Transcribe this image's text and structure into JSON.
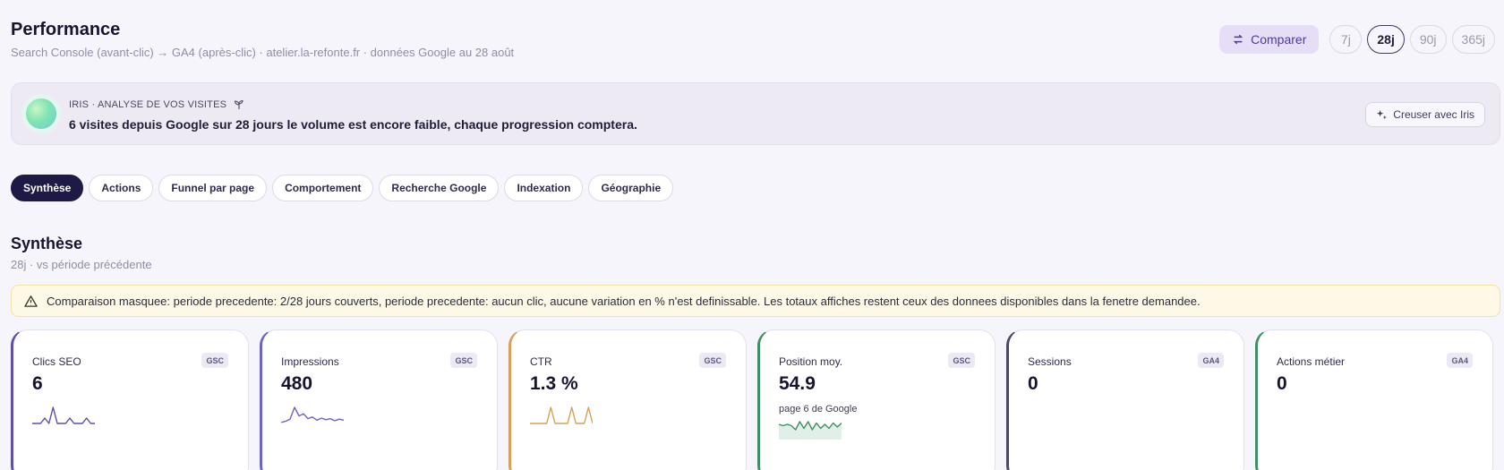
{
  "header": {
    "title": "Performance",
    "subtitle": "Search Console (avant-clic) → GA4 (après-clic) · atelier.la-refonte.fr · données Google au 28 août"
  },
  "controls": {
    "compare_label": "Comparer",
    "periods": [
      "7j",
      "28j",
      "90j",
      "365j"
    ],
    "active_period": "28j"
  },
  "iris": {
    "label": "IRIS · ANALYSE DE VOS VISITES",
    "message": "6 visites depuis Google sur 28 jours le volume est encore faible, chaque progression comptera.",
    "button_label": "Creuser avec Iris"
  },
  "tabs": [
    "Synthèse",
    "Actions",
    "Funnel par page",
    "Comportement",
    "Recherche Google",
    "Indexation",
    "Géographie"
  ],
  "active_tab": "Synthèse",
  "section": {
    "title": "Synthèse",
    "subtitle": "28j · vs période précédente"
  },
  "warning": {
    "text": "Comparaison masquee: periode precedente: 2/28 jours couverts, periode precedente: aucun clic, aucune variation en % n'est definissable. Les totaux affiches restent ceux des donnees disponibles dans la fenetre demandee."
  },
  "metrics": [
    {
      "label": "Clics SEO",
      "badge": "GSC",
      "value": "6",
      "note": "",
      "color": "#5b4fa8",
      "spark": [
        0,
        0,
        0,
        1,
        0,
        3,
        0,
        0,
        0,
        1,
        0,
        0,
        0,
        1,
        0,
        0
      ]
    },
    {
      "label": "Impressions",
      "badge": "GSC",
      "value": "480",
      "note": "",
      "color": "#6b66c4",
      "spark": [
        2,
        4,
        8,
        30,
        14,
        18,
        9,
        12,
        6,
        10,
        7,
        9,
        5,
        8,
        6
      ]
    },
    {
      "label": "CTR",
      "badge": "GSC",
      "value": "1.3 %",
      "note": "",
      "color": "#d4a05a",
      "spark": [
        0,
        0,
        0,
        0,
        0,
        2,
        0,
        0,
        0,
        0,
        2,
        0,
        0,
        0,
        2,
        0
      ]
    },
    {
      "label": "Position moy.",
      "badge": "GSC",
      "value": "54.9",
      "note": "page 6 de Google",
      "color": "#3f8f62",
      "spark": [
        10,
        9,
        10,
        9,
        6,
        12,
        7,
        12,
        6,
        11,
        7,
        10,
        7,
        11,
        8,
        11
      ]
    },
    {
      "label": "Sessions",
      "badge": "GA4",
      "value": "0",
      "note": "",
      "color": "#4b4866",
      "spark": []
    },
    {
      "label": "Actions métier",
      "badge": "GA4",
      "value": "0",
      "note": "",
      "color": "#3f8f62",
      "spark": []
    }
  ]
}
